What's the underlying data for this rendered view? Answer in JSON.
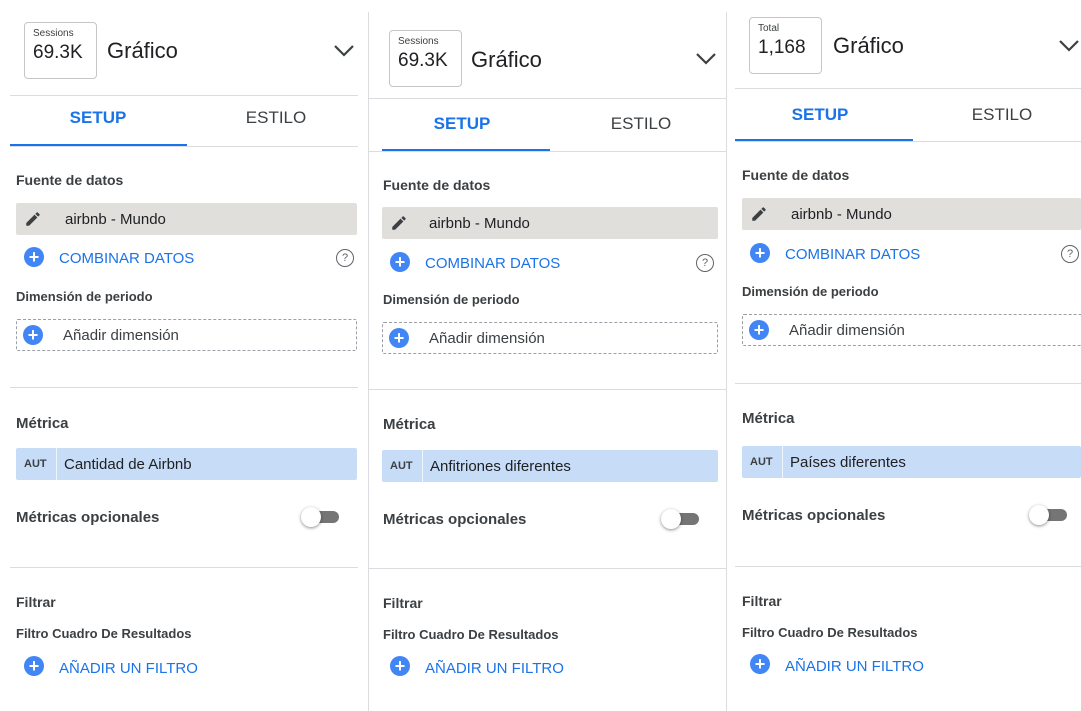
{
  "panels": [
    {
      "badge": {
        "label": "Sessions",
        "value": "69.3K"
      },
      "title": "Gráfico",
      "tabs": {
        "setup": "SETUP",
        "style": "ESTILO"
      },
      "data_source": {
        "section_label": "Fuente de datos",
        "name": "airbnb - Mundo",
        "blend_label": "COMBINAR DATOS"
      },
      "date_dimension": {
        "label": "Dimensión de periodo",
        "add_label": "Añadir dimensión"
      },
      "metric": {
        "section_label": "Métrica",
        "aggregation": "AUT",
        "name": "Cantidad de Airbnb"
      },
      "optional_metrics": {
        "label": "Métricas opcionales"
      },
      "filter": {
        "section_label": "Filtrar",
        "subsection_label": "Filtro Cuadro De Resultados",
        "add_label": "AÑADIR UN FILTRO"
      }
    },
    {
      "badge": {
        "label": "Sessions",
        "value": "69.3K"
      },
      "title": "Gráfico",
      "tabs": {
        "setup": "SETUP",
        "style": "ESTILO"
      },
      "data_source": {
        "section_label": "Fuente de datos",
        "name": "airbnb - Mundo",
        "blend_label": "COMBINAR DATOS"
      },
      "date_dimension": {
        "label": "Dimensión de periodo",
        "add_label": "Añadir dimensión"
      },
      "metric": {
        "section_label": "Métrica",
        "aggregation": "AUT",
        "name": "Anfitriones diferentes"
      },
      "optional_metrics": {
        "label": "Métricas opcionales"
      },
      "filter": {
        "section_label": "Filtrar",
        "subsection_label": "Filtro Cuadro De Resultados",
        "add_label": "AÑADIR UN FILTRO"
      }
    },
    {
      "badge": {
        "label": "Total",
        "value": "1,168"
      },
      "title": "Gráfico",
      "tabs": {
        "setup": "SETUP",
        "style": "ESTILO"
      },
      "data_source": {
        "section_label": "Fuente de datos",
        "name": "airbnb - Mundo",
        "blend_label": "COMBINAR DATOS"
      },
      "date_dimension": {
        "label": "Dimensión de periodo",
        "add_label": "Añadir dimensión"
      },
      "metric": {
        "section_label": "Métrica",
        "aggregation": "AUT",
        "name": "Países diferentes"
      },
      "optional_metrics": {
        "label": "Métricas opcionales"
      },
      "filter": {
        "section_label": "Filtrar",
        "subsection_label": "Filtro Cuadro De Resultados",
        "add_label": "AÑADIR UN FILTRO"
      }
    }
  ],
  "icons": {
    "plus": "+",
    "help": "?",
    "edit": "pencil-icon",
    "expand": "chevron-down-icon",
    "toggle": "toggle-off"
  },
  "colors": {
    "accent": "#1a73e8",
    "plus_button": "#4285f4",
    "metric_chip": "#c6dcf7",
    "datasource_chip": "#e1dfdc"
  }
}
